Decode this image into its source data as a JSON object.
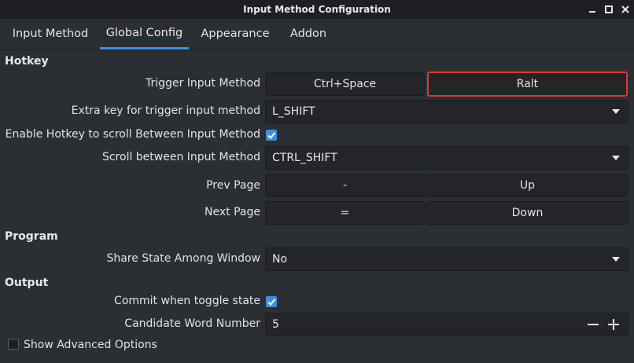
{
  "window": {
    "title": "Input Method Configuration"
  },
  "tabs": [
    {
      "label": "Input Method"
    },
    {
      "label": "Global Config"
    },
    {
      "label": "Appearance"
    },
    {
      "label": "Addon"
    }
  ],
  "sections": {
    "hotkey": "Hotkey",
    "program": "Program",
    "output": "Output"
  },
  "hotkey": {
    "trigger_label": "Trigger Input Method",
    "trigger_key1": "Ctrl+Space",
    "trigger_key2": "Ralt",
    "extra_label": "Extra key for trigger input method",
    "extra_value": "L_SHIFT",
    "enable_scroll_label": "Enable Hotkey to scroll Between Input Method",
    "enable_scroll_checked": true,
    "scroll_label": "Scroll between Input Method",
    "scroll_value": "CTRL_SHIFT",
    "prev_label": "Prev Page",
    "prev_key1": "-",
    "prev_key2": "Up",
    "next_label": "Next Page",
    "next_key1": "=",
    "next_key2": "Down"
  },
  "program": {
    "share_label": "Share State Among Window",
    "share_value": "No"
  },
  "output": {
    "commit_label": "Commit when toggle state",
    "commit_checked": true,
    "candidate_label": "Candidate Word Number",
    "candidate_value": "5"
  },
  "advanced": {
    "label": "Show Advanced Options",
    "checked": false
  },
  "colors": {
    "accent": "#3d8fe0",
    "highlight_border": "#d9383a",
    "background": "#2b2e33"
  }
}
